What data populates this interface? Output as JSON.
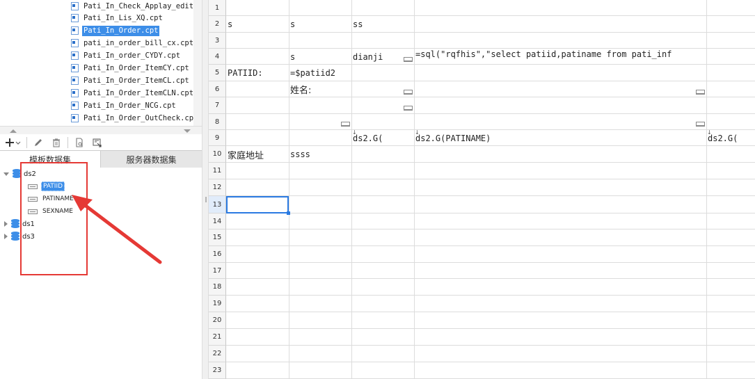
{
  "file_list": [
    {
      "name": "Pati_In_Check_Applay_edit.cpt",
      "selected": false
    },
    {
      "name": "Pati_In_Lis_XQ.cpt",
      "selected": false
    },
    {
      "name": "Pati_In_Order.cpt",
      "selected": true
    },
    {
      "name": "pati_in_order_bill_cx.cpt",
      "selected": false
    },
    {
      "name": "Pati_In_order_CYDY.cpt",
      "selected": false
    },
    {
      "name": "Pati_In_Order_ItemCY.cpt",
      "selected": false
    },
    {
      "name": "Pati_In_Order_ItemCL.cpt",
      "selected": false
    },
    {
      "name": "Pati_In_Order_ItemCLN.cpt",
      "selected": false
    },
    {
      "name": "Pati_In_Order_NCG.cpt",
      "selected": false
    },
    {
      "name": "Pati_In_Order_OutCheck.cpt",
      "selected": false
    }
  ],
  "toolbar": {
    "add_icon": "plus-icon",
    "add_dropdown": "▾",
    "edit_icon": "pencil-icon",
    "delete_icon": "trash-icon",
    "preview_icon": "preview-icon",
    "export_icon": "export-icon"
  },
  "tabs": {
    "template_dataset": "模板数据集",
    "server_dataset": "服务器数据集"
  },
  "tree": {
    "datasets": [
      {
        "name": "ds2",
        "expanded": true,
        "fields": [
          {
            "name": "PATIID",
            "selected": true
          },
          {
            "name": "PATINAME",
            "selected": false
          },
          {
            "name": "SEXNAME",
            "selected": false
          }
        ]
      },
      {
        "name": "ds1",
        "expanded": false,
        "fields": []
      },
      {
        "name": "ds3",
        "expanded": false,
        "fields": []
      }
    ]
  },
  "annotation": {
    "color": "#e53935"
  },
  "sheet": {
    "row_numbers": [
      "1",
      "2",
      "3",
      "4",
      "5",
      "6",
      "7",
      "8",
      "9",
      "10",
      "11",
      "12",
      "13",
      "14",
      "15",
      "16",
      "17",
      "18",
      "19",
      "20",
      "21",
      "22",
      "23"
    ],
    "cells": {
      "r2_a": "s",
      "r2_b": "s",
      "r2_c": "ss",
      "r4_b": "s",
      "r4_c": "dianji",
      "r4_d": "=sql(\"rqfhis\",\"select patiid,patiname from pati_inf",
      "r5_a": "PATIID:",
      "r5_b": "=$patiid2",
      "r6_b": "姓名:",
      "r9_c": "ds2.G(",
      "r9_d": "ds2.G(PATINAME)",
      "r9_e": "ds2.G(",
      "r10_a": "家庭地址",
      "r10_b": "ssss"
    },
    "accent": "#2a7ae2",
    "selected_row": "13"
  }
}
